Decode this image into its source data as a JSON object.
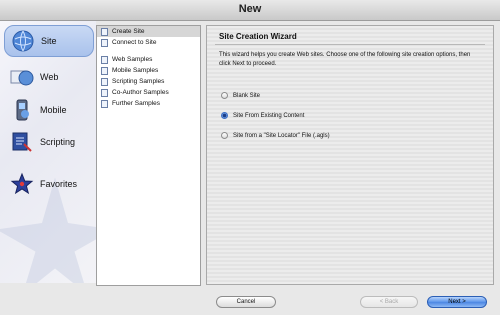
{
  "window": {
    "title": "New"
  },
  "categories": [
    {
      "label": "Site",
      "icon": "site-globe-icon",
      "selected": true
    },
    {
      "label": "Web",
      "icon": "web-globe-icon",
      "selected": false
    },
    {
      "label": "Mobile",
      "icon": "mobile-phone-icon",
      "selected": false
    },
    {
      "label": "Scripting",
      "icon": "scripting-document-icon",
      "selected": false
    },
    {
      "label": "Favorites",
      "icon": "favorites-star-icon",
      "selected": false
    }
  ],
  "list": {
    "groups": [
      [
        {
          "label": "Create Site",
          "selected": true
        },
        {
          "label": "Connect to Site",
          "selected": false
        }
      ],
      [
        {
          "label": "Web Samples",
          "selected": false
        },
        {
          "label": "Mobile Samples",
          "selected": false
        },
        {
          "label": "Scripting Samples",
          "selected": false
        },
        {
          "label": "Co-Author Samples",
          "selected": false
        },
        {
          "label": "Further Samples",
          "selected": false
        }
      ]
    ]
  },
  "wizard": {
    "heading": "Site Creation Wizard",
    "description": "This wizard helps you create Web sites. Choose one of the following site creation options, then click Next to proceed.",
    "options": [
      {
        "label": "Blank Site",
        "selected": false
      },
      {
        "label": "Site From Existing Content",
        "selected": true
      },
      {
        "label": "Site from a \"Site Locator\" File (.agls)",
        "selected": false
      }
    ]
  },
  "buttons": {
    "cancel": "Cancel",
    "back": "< Back",
    "next": "Next >"
  },
  "colors": {
    "selected_category": "#a9c2ec",
    "default_button": "#4a86e3",
    "selected_radio": "#3c78d8"
  }
}
